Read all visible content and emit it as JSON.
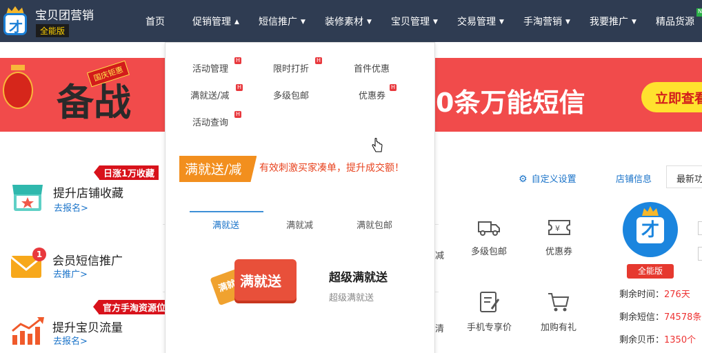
{
  "brand": {
    "name": "宝贝团营销",
    "edition": "全能版"
  },
  "nav": [
    {
      "label": "首页",
      "caret": false
    },
    {
      "label": "促销管理",
      "caret": true,
      "active": true
    },
    {
      "label": "短信推广",
      "caret": true
    },
    {
      "label": "装修素材",
      "caret": true
    },
    {
      "label": "宝贝管理",
      "caret": true
    },
    {
      "label": "交易管理",
      "caret": true
    },
    {
      "label": "手淘营销",
      "caret": true
    },
    {
      "label": "我要推广",
      "caret": true
    },
    {
      "label": "精品货源",
      "caret": false
    }
  ],
  "new_tag": "N",
  "banner": {
    "ribbon": "国庆钜惠",
    "headline": "备战",
    "sms_text": "0条万能短信",
    "button": "立即查看"
  },
  "features": [
    {
      "tag": "日涨1万收藏",
      "title": "提升店铺收藏",
      "link": "去报名>"
    },
    {
      "badge": "1",
      "title": "会员短信推广",
      "link": "去推广>"
    },
    {
      "tag": "官方手淘资源位",
      "title": "提升宝贝流量",
      "link": "去报名>"
    }
  ],
  "dropdown": {
    "items": [
      {
        "label": "活动管理",
        "hot": true
      },
      {
        "label": "限时打折",
        "hot": true
      },
      {
        "label": "首件优惠",
        "hot": false
      },
      {
        "label": "满就送/减",
        "hot": true
      },
      {
        "label": "多级包邮",
        "hot": false
      },
      {
        "label": "优惠券",
        "hot": true
      },
      {
        "label": "活动查询",
        "hot": true
      }
    ],
    "hot_mark": "H",
    "promo_title": "满就送/减",
    "promo_desc": "有效刺激买家凑单，提升成交额！",
    "tabs": [
      "满就送",
      "满就减",
      "满就包邮"
    ],
    "card": {
      "image_text": "满就送",
      "image_text_back": "满就",
      "title": "超级满就送",
      "subtitle": "超级满就送"
    }
  },
  "right": {
    "custom_settings": "自定义设置",
    "shop_info": "店铺信息",
    "latest": "最新功能",
    "tools": [
      "多级包邮",
      "优惠券",
      "手机专享价",
      "加购有礼"
    ],
    "cut_labels": [
      "减",
      "清"
    ],
    "edition_button": "全能版",
    "stats": [
      {
        "label": "剩余时间：",
        "value": "276",
        "unit": "天"
      },
      {
        "label": "剩余短信：",
        "value": "74578",
        "unit": "条"
      },
      {
        "label": "剩余贝币：",
        "value": "1350",
        "unit": "个"
      }
    ]
  }
}
